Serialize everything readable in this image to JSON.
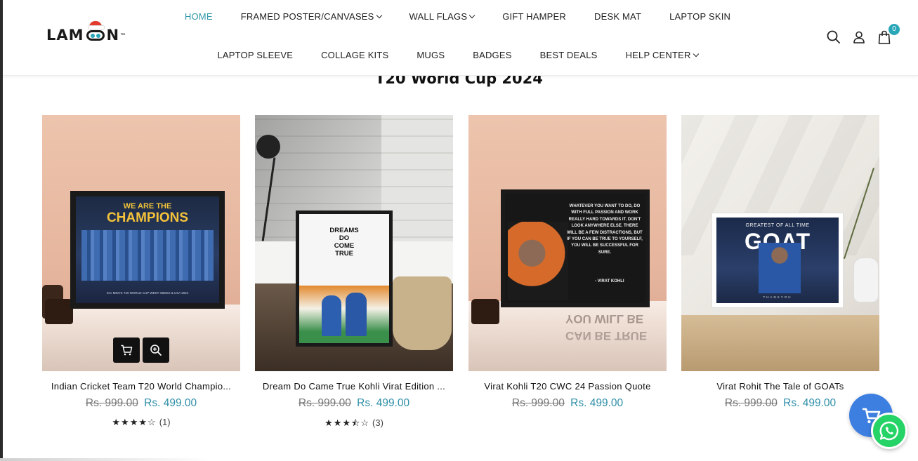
{
  "brand": {
    "logo_left": "LAM",
    "logo_right": "N",
    "logo_tm": "™"
  },
  "nav": {
    "row1": [
      {
        "label": "HOME",
        "active": true,
        "dropdown": false
      },
      {
        "label": "FRAMED POSTER/CANVASES",
        "active": false,
        "dropdown": true
      },
      {
        "label": "WALL FLAGS",
        "active": false,
        "dropdown": true
      },
      {
        "label": "GIFT HAMPER",
        "active": false,
        "dropdown": false
      },
      {
        "label": "DESK MAT",
        "active": false,
        "dropdown": false
      },
      {
        "label": "LAPTOP SKIN",
        "active": false,
        "dropdown": false
      }
    ],
    "row2": [
      {
        "label": "LAPTOP SLEEVE",
        "active": false,
        "dropdown": false
      },
      {
        "label": "COLLAGE KITS",
        "active": false,
        "dropdown": false
      },
      {
        "label": "MUGS",
        "active": false,
        "dropdown": false
      },
      {
        "label": "BADGES",
        "active": false,
        "dropdown": false
      },
      {
        "label": "BEST DEALS",
        "active": false,
        "dropdown": false
      },
      {
        "label": "HELP CENTER",
        "active": false,
        "dropdown": true
      }
    ]
  },
  "header_icons": {
    "search": "search-icon",
    "account": "user-icon",
    "cart": "shopping-bag-icon",
    "cart_count": "0"
  },
  "section": {
    "title": "T20 World Cup 2024"
  },
  "products": [
    {
      "name": "Indian Cricket Team T20 World Champio...",
      "old_price": "Rs. 999.00",
      "new_price": "Rs. 499.00",
      "stars": "★★★★☆",
      "rating": 4,
      "reviews": "(1)",
      "poster_line1": "WE ARE THE",
      "poster_line2": "CHAMPIONS",
      "poster_footer": "ICC MEN'S T20 WORLD CUP WEST INDIES & USA 2024"
    },
    {
      "name": "Dream Do Came True Kohli Virat Edition ...",
      "old_price": "Rs. 999.00",
      "new_price": "Rs. 499.00",
      "stars": "★★★⯪☆",
      "rating": 3.5,
      "reviews": "(3)",
      "poster_line1": "DREAMS",
      "poster_line2": "DO",
      "poster_line3": "COME",
      "poster_line4": "TRUE"
    },
    {
      "name": "Virat Kohli T20 CWC 24 Passion Quote",
      "old_price": "Rs. 999.00",
      "new_price": "Rs. 499.00",
      "quote": "WHATEVER YOU WANT TO DO, DO WITH FULL PASSION AND WORK REALLY HARD TOWARDS IT. DON'T LOOK ANYWHERE ELSE. THERE WILL BE A FEW DISTRACTIONS, BUT IF YOU CAN BE TRUE TO YOURSELF, YOU WILL BE SUCCESSFUL FOR SURE.",
      "quote_author": "- VIRAT KOHLI",
      "reflection1": "YOU WILL BE",
      "reflection2": "CAN BE TRUE"
    },
    {
      "name": "Virat Rohit The Tale of GOATs",
      "old_price": "Rs. 999.00",
      "new_price": "Rs. 499.00",
      "poster_small": "GREATEST OF ALL TIME",
      "poster_big": "GOAT",
      "poster_footer": "THANKYOU"
    }
  ],
  "colors": {
    "accent": "#2f97a8",
    "price": "#2f8fa8",
    "float_cart": "#3d7fe0",
    "whatsapp": "#25d366"
  }
}
